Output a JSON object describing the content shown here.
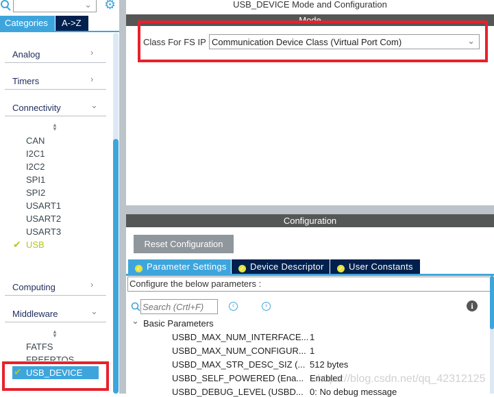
{
  "sidebar": {
    "search_value": "",
    "tabs": [
      "Categories",
      "A->Z"
    ],
    "categories": [
      {
        "label": "Analog",
        "expanded": false
      },
      {
        "label": "Timers",
        "expanded": false
      },
      {
        "label": "Connectivity",
        "expanded": true
      },
      {
        "label": "Computing",
        "expanded": false
      },
      {
        "label": "Middleware",
        "expanded": true
      }
    ],
    "connectivity_items": [
      "CAN",
      "I2C1",
      "I2C2",
      "SPI1",
      "SPI2",
      "USART1",
      "USART2",
      "USART3",
      "USB"
    ],
    "middleware_items": [
      "FATFS",
      "FREERTOS",
      "USB_DEVICE"
    ],
    "selected": "USB_DEVICE"
  },
  "main": {
    "title": "USB_DEVICE Mode and Configuration",
    "mode_header": "Mode",
    "class_label": "Class For FS IP",
    "class_value": "Communication Device Class (Virtual Port Com)",
    "config_header": "Configuration",
    "reset_label": "Reset Configuration",
    "tabs": [
      "Parameter Settings",
      "Device Descriptor",
      "User Constants"
    ],
    "hint": "Configure the below parameters :",
    "search_placeholder": "Search (Crtl+F)",
    "group": "Basic Parameters",
    "params": [
      {
        "name": "USBD_MAX_NUM_INTERFACE...",
        "value": "1"
      },
      {
        "name": "USBD_MAX_NUM_CONFIGUR...",
        "value": "1"
      },
      {
        "name": "USBD_MAX_STR_DESC_SIZ (...",
        "value": "512 bytes"
      },
      {
        "name": "USBD_SELF_POWERED (Ena...",
        "value": "Enabled"
      },
      {
        "name": "USBD_DEBUG_LEVEL (USBD...",
        "value": "0: No debug message"
      }
    ]
  },
  "watermark": "https://blog.csdn.net/qq_42312125",
  "colors": {
    "accent": "#3ea5dc",
    "navy": "#00204e",
    "header": "#555756",
    "check": "#b5c819",
    "highlight": "#e8212a"
  }
}
